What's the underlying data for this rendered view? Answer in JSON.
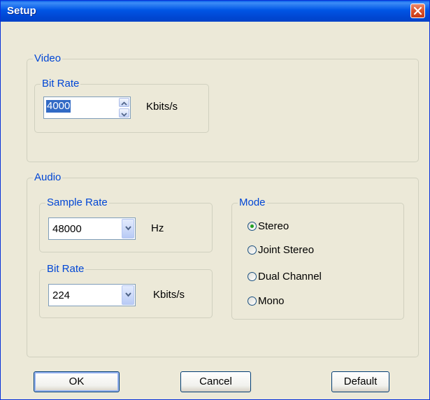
{
  "window": {
    "title": "Setup"
  },
  "video": {
    "group_label": "Video",
    "bitrate": {
      "group_label": "Bit Rate",
      "value": "4000",
      "unit": "Kbits/s"
    }
  },
  "audio": {
    "group_label": "Audio",
    "sample_rate": {
      "group_label": "Sample Rate",
      "value": "48000",
      "unit": "Hz"
    },
    "bitrate": {
      "group_label": "Bit Rate",
      "value": "224",
      "unit": "Kbits/s"
    },
    "mode": {
      "group_label": "Mode",
      "options": [
        {
          "label": "Stereo",
          "selected": true
        },
        {
          "label": "Joint Stereo",
          "selected": false
        },
        {
          "label": "Dual Channel",
          "selected": false
        },
        {
          "label": "Mono",
          "selected": false
        }
      ]
    }
  },
  "buttons": {
    "ok": "OK",
    "cancel": "Cancel",
    "default": "Default"
  },
  "colors": {
    "title_bar": "#0055e5",
    "group_label": "#0046d5",
    "dialog_bg": "#ece9d8",
    "close": "#d9512b"
  }
}
